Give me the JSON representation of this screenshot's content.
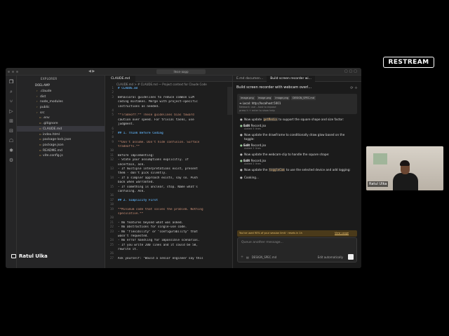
{
  "brand": {
    "name": "RESTREAM"
  },
  "titlebar": {
    "search": "llean-aapp"
  },
  "explorer": {
    "header": "EXPLORER",
    "project": "DOEL-AMP",
    "items": [
      {
        "label": ".claude",
        "type": "folder"
      },
      {
        "label": "dist",
        "type": "folder"
      },
      {
        "label": "node_modules",
        "type": "folder"
      },
      {
        "label": "public",
        "type": "folder"
      },
      {
        "label": "src",
        "type": "folder"
      },
      {
        "label": ".env",
        "type": "file"
      },
      {
        "label": ".gitignore",
        "type": "file"
      },
      {
        "label": "CLAUDE.md",
        "type": "file",
        "selected": true
      },
      {
        "label": "index.html",
        "type": "file"
      },
      {
        "label": "package-lock.json",
        "type": "file"
      },
      {
        "label": "package.json",
        "type": "file"
      },
      {
        "label": "README.md",
        "type": "file"
      },
      {
        "label": "vite.config.js",
        "type": "file"
      }
    ]
  },
  "editor": {
    "tab": "CLAUDE.md",
    "breadcrumb": "CLAUDE.md > # CLAUDE.md — Project context for Claude Code",
    "lines": [
      {
        "n": "1",
        "t": "# CLAUDE.md",
        "k": "h"
      },
      {
        "n": "2",
        "t": "",
        "k": ""
      },
      {
        "n": "3",
        "t": "Behavioral guidelines to reduce common LLM",
        "k": ""
      },
      {
        "n": "",
        "t": "coding mistakes. Merge with project-specific",
        "k": ""
      },
      {
        "n": "",
        "t": "instructions as needed.",
        "k": ""
      },
      {
        "n": "4",
        "t": "",
        "k": ""
      },
      {
        "n": "5",
        "t": "**Tradeoff:** These guidelines bias toward",
        "k": "b"
      },
      {
        "n": "",
        "t": "caution over speed. For trivial tasks, use",
        "k": ""
      },
      {
        "n": "",
        "t": "judgment.",
        "k": ""
      },
      {
        "n": "6",
        "t": "",
        "k": ""
      },
      {
        "n": "7",
        "t": "## 1. Think Before Coding",
        "k": "h"
      },
      {
        "n": "8",
        "t": "",
        "k": ""
      },
      {
        "n": "9",
        "t": "**Don't assume. Don't hide confusion. Surface",
        "k": "b"
      },
      {
        "n": "",
        "t": "tradeoffs.**",
        "k": "b"
      },
      {
        "n": "10",
        "t": "",
        "k": ""
      },
      {
        "n": "11",
        "t": "Before implementing:",
        "k": ""
      },
      {
        "n": "12",
        "t": "- State your assumptions explicitly. If",
        "k": ""
      },
      {
        "n": "",
        "t": "uncertain, ask.",
        "k": ""
      },
      {
        "n": "13",
        "t": "- If multiple interpretations exist, present",
        "k": ""
      },
      {
        "n": "",
        "t": "them - don't pick silently.",
        "k": ""
      },
      {
        "n": "14",
        "t": "- If a simpler approach exists, say so. Push",
        "k": ""
      },
      {
        "n": "",
        "t": "back when warranted.",
        "k": ""
      },
      {
        "n": "15",
        "t": "- If something is unclear, stop. Name what's",
        "k": ""
      },
      {
        "n": "",
        "t": "confusing. Ask.",
        "k": ""
      },
      {
        "n": "16",
        "t": "",
        "k": ""
      },
      {
        "n": "17",
        "t": "## 2. Simplicity First",
        "k": "h"
      },
      {
        "n": "18",
        "t": "",
        "k": ""
      },
      {
        "n": "19",
        "t": "**Minimum code that solves the problem. Nothing",
        "k": "b"
      },
      {
        "n": "",
        "t": "speculative.**",
        "k": "b"
      },
      {
        "n": "20",
        "t": "",
        "k": ""
      },
      {
        "n": "21",
        "t": "- No features beyond what was asked.",
        "k": ""
      },
      {
        "n": "22",
        "t": "- No abstractions for single-use code.",
        "k": ""
      },
      {
        "n": "23",
        "t": "- No \"flexibility\" or \"configurability\" that",
        "k": ""
      },
      {
        "n": "",
        "t": "wasn't requested.",
        "k": ""
      },
      {
        "n": "24",
        "t": "- No error handling for impossible scenarios.",
        "k": ""
      },
      {
        "n": "25",
        "t": "- If you write 200 lines and it could be 50,",
        "k": ""
      },
      {
        "n": "",
        "t": "rewrite it.",
        "k": ""
      },
      {
        "n": "26",
        "t": "",
        "k": ""
      },
      {
        "n": "27",
        "t": "Ask yourself: \"Would a senior engineer say this",
        "k": ""
      }
    ]
  },
  "chat": {
    "tabs": [
      "E.md documen...",
      "Build screen recorder wi..."
    ],
    "title": "Build screen recorder with webcam overl...",
    "chips": [
      "image.png",
      "image.png",
      "image.png",
      "DESIGN_SPEC.md"
    ],
    "local_label": "Local",
    "local_url": "http://localhost:5001",
    "local_sub": "Network: use --host to expose",
    "local_sub2": "press h + enter to show help",
    "messages": [
      {
        "kind": "msg",
        "text": "Now update",
        "code": "getMedia",
        "rest": "to support the square shape and size factor:"
      },
      {
        "kind": "edit",
        "verb": "Edit",
        "file": "Record.jsx",
        "sub": "Added 5 lines"
      },
      {
        "kind": "msg",
        "text": "Now update the drawFrame to conditionally draw glow based on the toggle:",
        "code": "",
        "rest": ""
      },
      {
        "kind": "edit",
        "verb": "Edit",
        "file": "Record.jsx",
        "sub": "Added 2 lines"
      },
      {
        "kind": "msg",
        "text": "Now update the webcam-clip to handle the square shape:",
        "code": "",
        "rest": ""
      },
      {
        "kind": "edit",
        "verb": "Edit",
        "file": "Record.jsx",
        "sub": "Added 2 lines"
      },
      {
        "kind": "msg",
        "text": "Now update the",
        "code": "toggleCam",
        "rest": "to use the selected device and add logging:"
      },
      {
        "kind": "msg",
        "text": "Cooking...",
        "code": "",
        "rest": ""
      }
    ],
    "usage_text": "You've used 90% of your session limit · resets in 1h",
    "usage_link": "View usage",
    "input_placeholder": "Queue another message...",
    "footer_file": "DESIGN_SPEC.md",
    "footer_mode": "Edit automatically"
  },
  "webcam": {
    "name": "Ratul Ulka"
  },
  "host": {
    "name": "Ratul Ulka"
  }
}
